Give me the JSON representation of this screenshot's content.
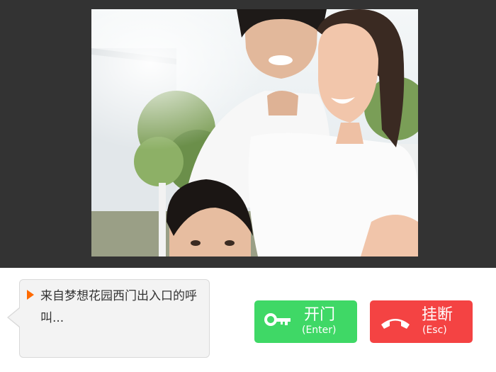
{
  "incoming_call": {
    "message": "来自梦想花园西门出入口的呼叫..."
  },
  "actions": {
    "open_door": {
      "label": "开门",
      "shortcut": "(Enter)",
      "color": "#3fd866",
      "icon": "key-icon"
    },
    "hang_up": {
      "label": "挂断",
      "shortcut": "(Esc)",
      "color": "#f44343",
      "icon": "phone-hangup-icon"
    }
  },
  "colors": {
    "background_dark": "#333333",
    "accent_orange": "#ff6a00"
  }
}
